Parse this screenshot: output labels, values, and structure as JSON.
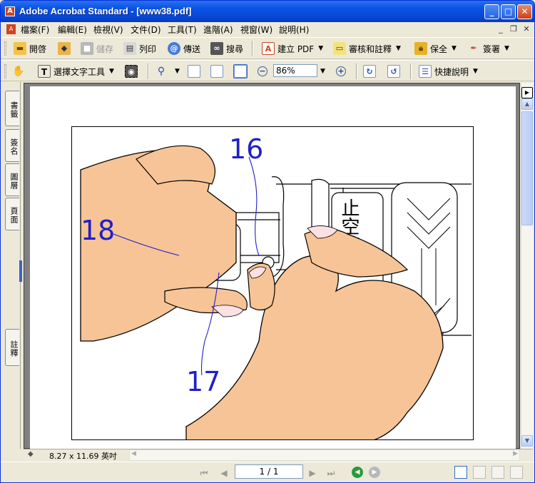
{
  "window": {
    "title": "Adobe Acrobat Standard - [www38.pdf]",
    "app_icon": "acrobat-icon"
  },
  "menu": [
    "檔案(F)",
    "編輯(E)",
    "檢視(V)",
    "文件(D)",
    "工具(T)",
    "進階(A)",
    "視窗(W)",
    "說明(H)"
  ],
  "toolbar1": {
    "open": "開啓",
    "save": "儲存",
    "print": "列印",
    "send": "傳送",
    "search": "搜尋",
    "create_pdf": "建立 PDF",
    "review": "審核和註釋",
    "secure": "保全",
    "sign": "簽署"
  },
  "toolbar2": {
    "select_text": "選擇文字工具",
    "zoom_value": "86%",
    "how_to": "快捷說明"
  },
  "navtabs": [
    "書籤",
    "簽名",
    "圖層",
    "頁面",
    "註釋"
  ],
  "illustration": {
    "callout_16": "16",
    "callout_17": "17",
    "callout_18": "18",
    "label_text": "止空轉"
  },
  "status": {
    "page_size": "8.27 x 11.69 英吋"
  },
  "navigation": {
    "page_display": "1 / 1"
  },
  "colors": {
    "title_blue": "#0a54e2",
    "skin": "#f6c496",
    "callout_blue": "#2020c8"
  }
}
